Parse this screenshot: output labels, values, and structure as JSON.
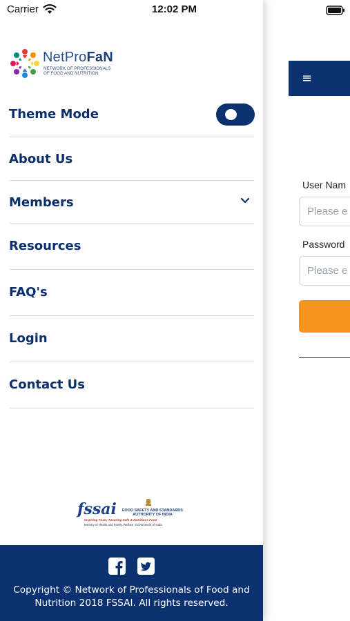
{
  "status_bar": {
    "carrier": "Carrier",
    "time": "12:02 PM",
    "wifi_icon": "wifi-icon",
    "battery_icon": "battery-icon"
  },
  "background_screen": {
    "menu_icon": "≡",
    "username_label": "User Nam",
    "username_placeholder": "Please e",
    "password_label": "Password",
    "password_placeholder": "Please e",
    "accent_color": "#f7941d",
    "header_color": "#0b3170"
  },
  "drawer": {
    "logo": {
      "brand_light": "NetPro",
      "brand_bold": "FaN",
      "tagline_line1": "NETWORK OF PROFESSIONALS",
      "tagline_line2": "OF FOOD AND NUTRITION"
    },
    "items": [
      {
        "label": "Theme Mode",
        "control": "toggle",
        "toggle_on": true
      },
      {
        "label": "About Us"
      },
      {
        "label": "Members",
        "icon": "chevron-down-icon"
      },
      {
        "label": "Resources"
      },
      {
        "label": "FAQ's"
      },
      {
        "label": "Login"
      },
      {
        "label": "Contact Us"
      }
    ],
    "fssai": {
      "wordmark": "fssai",
      "authority_line1": "FOOD SAFETY AND STANDARDS",
      "authority_line2": "AUTHORITY OF INDIA",
      "tagline": "Inspiring Trust, Assuring Safe & Nutritious Food",
      "ministry": "Ministry of Health and Family Welfare, Government of India"
    },
    "footer": {
      "social": [
        "facebook-icon",
        "twitter-icon"
      ],
      "copyright_line1": "Copyright © Network of Professionals of Food and",
      "copyright_line2": "Nutrition 2018 FSSAI. All rights reserved.",
      "color": "#0b3170"
    }
  }
}
